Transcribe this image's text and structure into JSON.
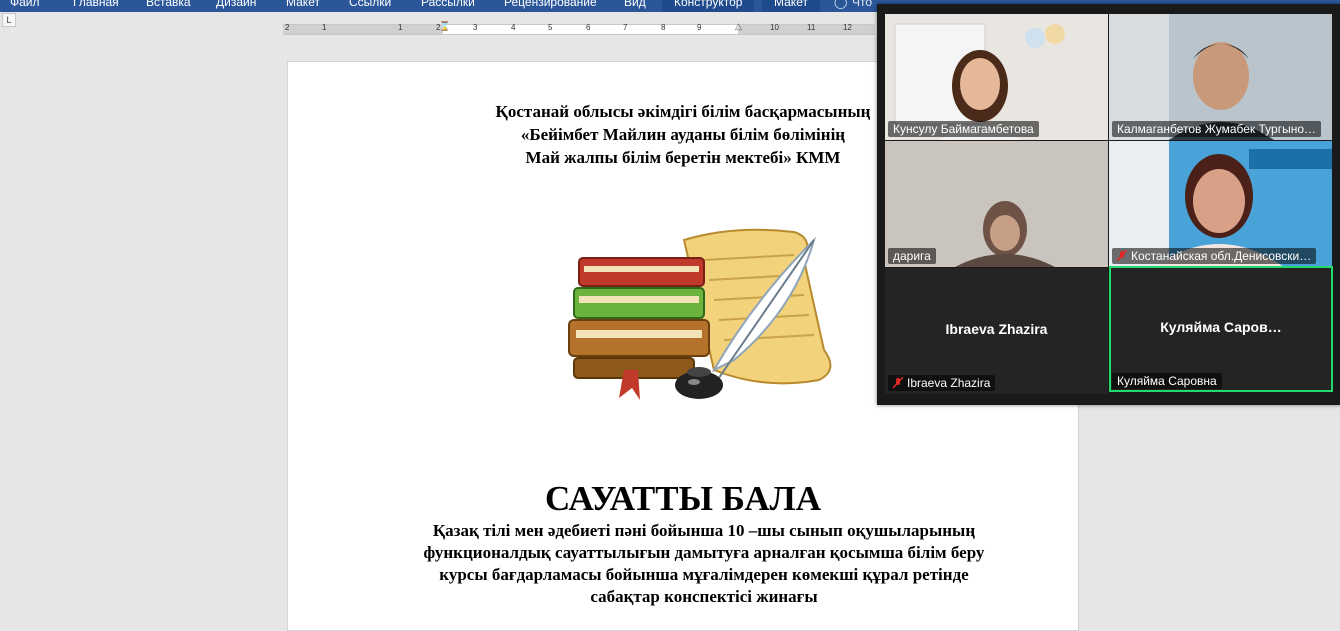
{
  "ribbon": {
    "tabs": [
      {
        "label": "Файл",
        "active": false
      },
      {
        "label": "Главная",
        "active": false
      },
      {
        "label": "Вставка",
        "active": false
      },
      {
        "label": "Дизайн",
        "active": false
      },
      {
        "label": "Макет",
        "active": false
      },
      {
        "label": "Ссылки",
        "active": false
      },
      {
        "label": "Рассылки",
        "active": false
      },
      {
        "label": "Рецензирование",
        "active": false
      },
      {
        "label": "Вид",
        "active": false
      },
      {
        "label": "Конструктор",
        "active": true
      },
      {
        "label": "Макет",
        "active": true
      }
    ],
    "tell_me": "Что"
  },
  "ruler": {
    "numbers": [
      "2",
      "1",
      "1",
      "2",
      "3",
      "4",
      "5",
      "6",
      "7",
      "8",
      "9",
      "10",
      "11",
      "12"
    ]
  },
  "document": {
    "header_lines": [
      "Қостанай облысы әкімдігі білім басқармасының",
      "«Бейімбет Майлин  ауданы білім бөлімінің",
      "Май жалпы білім беретін мектебі» КММ"
    ],
    "title": "САУАТТЫ БАЛА",
    "subtitle_lines": [
      "Қазақ тілі мен әдебиеті пәні бойынша 10 –шы сынып оқушыларының",
      "функционалдық сауаттылығын  дамытуға арналған қосымша білім беру",
      "курсы бағдарламасы бойынша мұғалімдерен көмекші құрал  ретінде",
      "сабақтар конспектісі жинағы"
    ]
  },
  "zoom": {
    "participants": [
      {
        "name": "Кунсулу Баймагамбетова",
        "muted": false,
        "video": true
      },
      {
        "name": "Калмаганбетов Жумабек Тургыно…",
        "muted": false,
        "video": true
      },
      {
        "name": "дарига",
        "muted": false,
        "video": true
      },
      {
        "name": "Костанайская обл.Денисовски…",
        "muted": true,
        "video": true
      },
      {
        "name": "Ibraeva Zhazira",
        "display": "Ibraeva Zhazira",
        "muted": true,
        "video": false
      },
      {
        "name": "Куляйма Саровна",
        "display": "Куляйма  Саров…",
        "muted": false,
        "video": false,
        "active_speaker": true
      }
    ]
  },
  "colors": {
    "ribbon": "#2b579a",
    "zoom_bg": "#1a1a1a",
    "active_speaker": "#23d96c",
    "mute": "#e02828"
  }
}
